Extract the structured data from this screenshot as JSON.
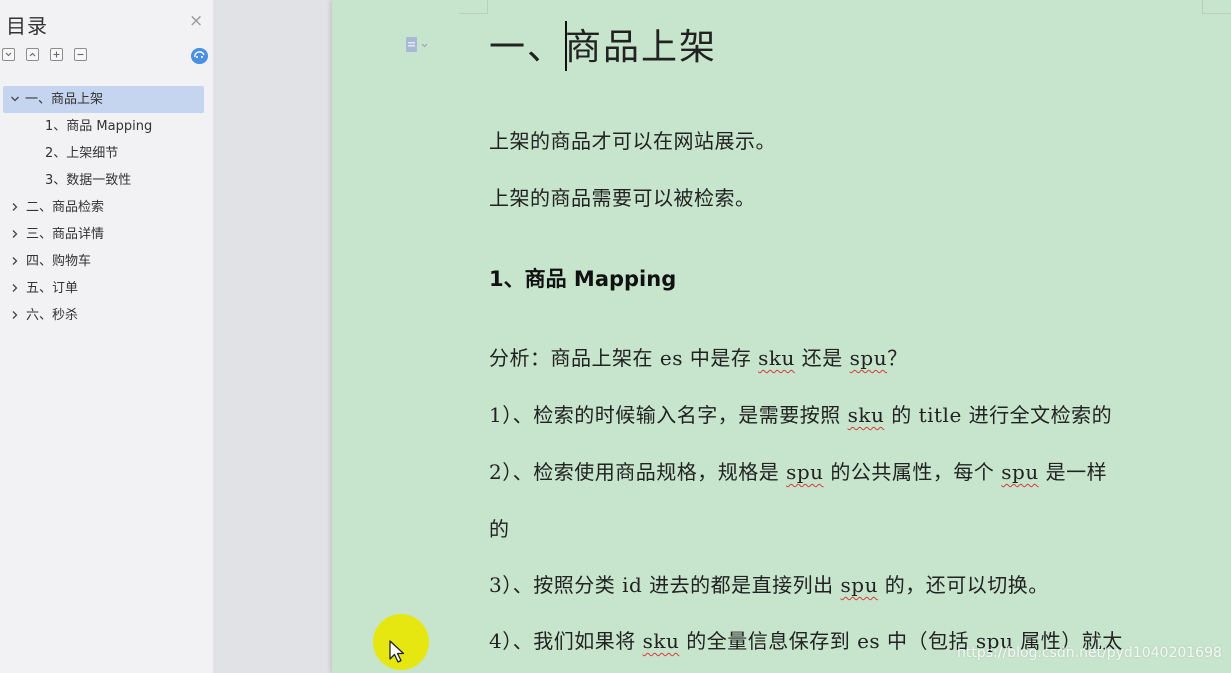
{
  "toc": {
    "title": "目录",
    "close_glyph": "×",
    "items": [
      {
        "label": "一、商品上架",
        "level": 0,
        "expanded": true,
        "selected": true
      },
      {
        "label": "1、商品 Mapping",
        "level": 1
      },
      {
        "label": "2、上架细节",
        "level": 1
      },
      {
        "label": "3、数据一致性",
        "level": 1
      },
      {
        "label": "二、商品检索",
        "level": 0,
        "expanded": false
      },
      {
        "label": "三、商品详情",
        "level": 0,
        "expanded": false
      },
      {
        "label": "四、购物车",
        "level": 0,
        "expanded": false
      },
      {
        "label": "五、订单",
        "level": 0,
        "expanded": false
      },
      {
        "label": "六、秒杀",
        "level": 0,
        "expanded": false
      }
    ],
    "tool_icons": [
      "collapse-all-icon",
      "expand-all-icon",
      "add-level-icon",
      "remove-level-icon",
      "sync-icon"
    ]
  },
  "doc": {
    "title": "一、商品上架",
    "p1": "上架的商品才可以在网站展示。",
    "p2": "上架的商品需要可以被检索。",
    "h_mapping": "1、商品 Mapping",
    "analysis": {
      "a": "分析：商品上架在 es 中是存 ",
      "sku": "sku",
      "b": " 还是 ",
      "spu": "spu",
      "c": "？"
    },
    "l1": {
      "a": "1）、检索的时候输入名字，是需要按照 ",
      "sku": "sku",
      "b": " 的 title 进行全文检索的"
    },
    "l2": {
      "a": "2）、检索使用商品规格，规格是 ",
      "spu": "spu",
      "b": " 的公共属性，每个 ",
      "spu2": "spu",
      "c": " 是一样"
    },
    "l2_cont": "的",
    "l3": {
      "a": "3）、按照分类 id 进去的都是直接列出 ",
      "spu": "spu",
      "b": " 的，还可以切换。"
    },
    "l4": {
      "a": "4）、我们如果将 ",
      "sku": "sku",
      "b": " 的全量信息保存到 es 中（包括 ",
      "spu": "spu",
      "c": " 属性）就太"
    }
  },
  "watermark": "https://blog.csdn.net/pyd1040201698",
  "colors": {
    "page_background": "#c7e5cc",
    "sidebar_background": "#f2f2f4",
    "selected_item": "#c5d4ef",
    "spellcheck_underline": "#d43b3b",
    "cursor_highlight": "#e8e600"
  }
}
